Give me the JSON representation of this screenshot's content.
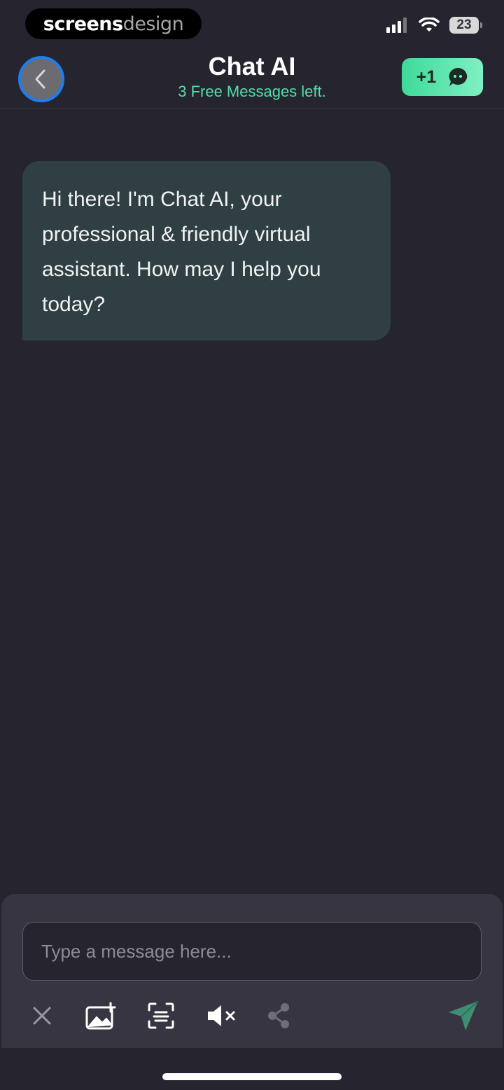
{
  "status_bar": {
    "brand_part1": "screens",
    "brand_part2": "design",
    "battery": "23"
  },
  "header": {
    "title": "Chat AI",
    "subtitle": "3 Free Messages left.",
    "plus_label": "+1"
  },
  "messages": [
    {
      "sender": "assistant",
      "text": "Hi there! I'm Chat AI, your professional & friendly virtual assistant. How may I help you today?"
    }
  ],
  "composer": {
    "placeholder": "Type a message here..."
  },
  "toolbar": {
    "icons": [
      "close-icon",
      "add-image-icon",
      "scan-text-icon",
      "mute-icon",
      "share-icon",
      "send-icon"
    ]
  },
  "colors": {
    "background": "#26252f",
    "accent": "#4fe0a8",
    "bubble": "#2f3f44",
    "composer": "#363541"
  }
}
